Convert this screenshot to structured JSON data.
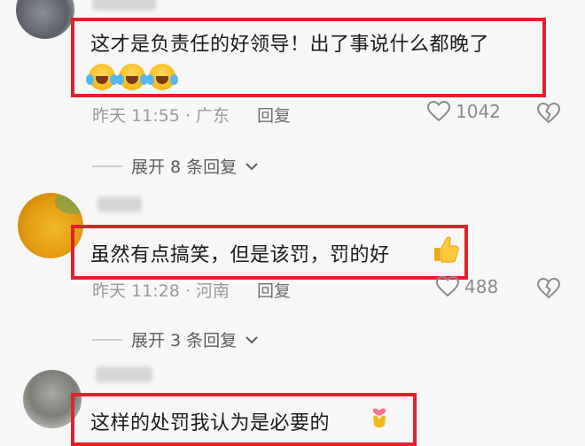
{
  "comments": [
    {
      "username": "",
      "text": "这才是负责任的好领导！出了事说什么都晚了",
      "emojis": [
        "laughing-crying",
        "laughing-crying",
        "laughing-crying"
      ],
      "time_location": "昨天 11:55 · 广东",
      "reply_label": "回复",
      "likes": "1042",
      "expand_label": "展开 8 条回复"
    },
    {
      "username": "",
      "text": "虽然有点搞笑，但是该罚，罚的好",
      "emojis": [
        "thumbs-up"
      ],
      "time_location": "昨天 11:28 · 河南",
      "reply_label": "回复",
      "likes": "488",
      "expand_label": "展开 3 条回复"
    },
    {
      "username": "",
      "text": "这样的处罚我认为是必要的",
      "emojis": [
        "finger-heart"
      ]
    }
  ],
  "colors": {
    "highlight": "#e3202a",
    "meta": "#9a9a9a",
    "background": "#f7f7f7"
  }
}
